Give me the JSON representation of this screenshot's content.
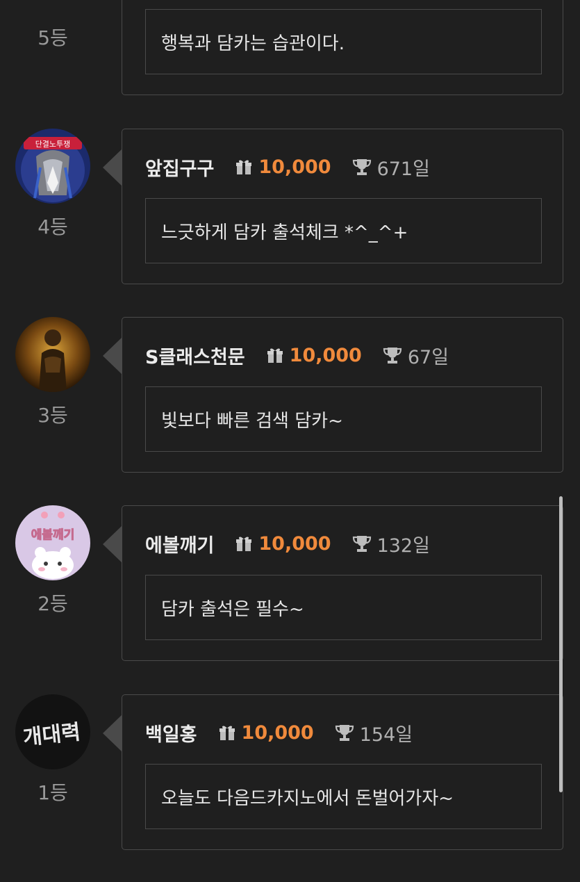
{
  "entries": [
    {
      "rank": "5등",
      "nickname": "",
      "points": "",
      "days": "",
      "message": "행복과 담카는 습관이다.",
      "avatar_icon": "none"
    },
    {
      "rank": "4등",
      "nickname": "앞집구구",
      "points": "10,000",
      "days": "671일",
      "message": "느긋하게 담카 출석체크 *^_^+",
      "avatar_icon": "pigeon-avatar",
      "avatar_banner_text": "단결노투쟁"
    },
    {
      "rank": "3등",
      "nickname": "S클래스천문",
      "points": "10,000",
      "days": "67일",
      "message": "빛보다 빠른 검색 담카~",
      "avatar_icon": "golden-statue-avatar"
    },
    {
      "rank": "2등",
      "nickname": "에볼깨기",
      "points": "10,000",
      "days": "132일",
      "message": "담카 출석은 필수~",
      "avatar_icon": "cute-cat-avatar",
      "avatar_text": "에볼깨기"
    },
    {
      "rank": "1등",
      "nickname": "백일홍",
      "points": "10,000",
      "days": "154일",
      "message": "오늘도 다음드카지노에서 돈벌어가자~",
      "avatar_icon": "neon-text-avatar",
      "avatar_text": "개대력"
    }
  ],
  "colors": {
    "background": "#1f1f1f",
    "border": "#4a4a4a",
    "points": "#f08a3c",
    "rank_text": "#9a9a9a"
  }
}
